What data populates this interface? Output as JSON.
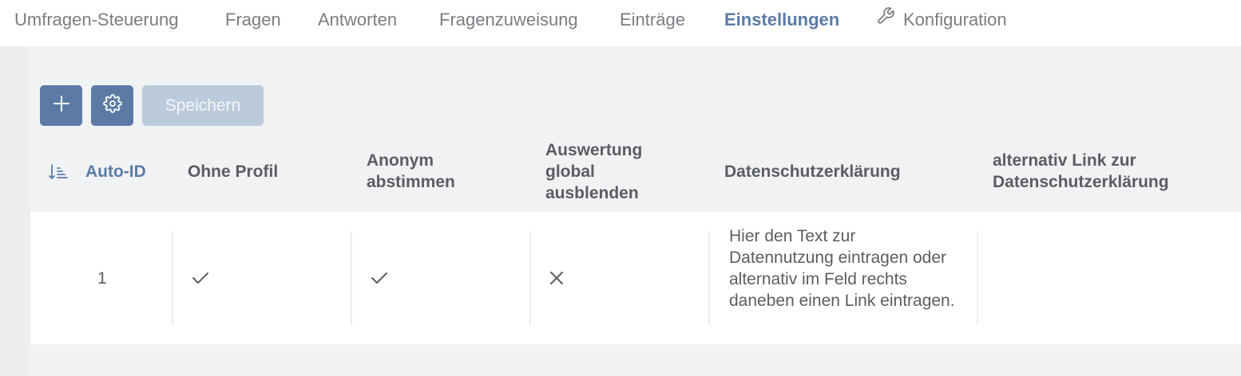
{
  "tabs": [
    {
      "label": "Umfragen-Steuerung",
      "active": false
    },
    {
      "label": "Fragen",
      "active": false
    },
    {
      "label": "Antworten",
      "active": false
    },
    {
      "label": "Fragenzuweisung",
      "active": false
    },
    {
      "label": "Einträge",
      "active": false
    },
    {
      "label": "Einstellungen",
      "active": true
    },
    {
      "label": "Konfiguration",
      "active": false,
      "icon": "wrench-icon"
    }
  ],
  "toolbar": {
    "add_icon": "plus-icon",
    "settings_icon": "gear-icon",
    "save_label": "Speichern"
  },
  "table": {
    "sort_icon": "sort-ascending-icon",
    "columns": [
      "Auto-ID",
      "Ohne Profil",
      "Anonym abstimmen",
      "Auswertung global ausblenden",
      "Datenschutzerklärung",
      "alternativ Link zur Datenschutzerklärung"
    ],
    "rows": [
      {
        "auto_id": "1",
        "ohne_profil": "check-icon",
        "anonym_abstimmen": "check-icon",
        "auswertung_ausblenden": "x-icon",
        "datenschutz": "Hier den Text zur Datennutzung eintragen oder alternativ im Feld rechts daneben einen Link eintragen.",
        "alternativ_link": ""
      }
    ]
  },
  "colors": {
    "accent": "#5b7ba6",
    "accent_disabled": "#bccbdc",
    "background": "#f1f2f4",
    "text": "#5a5d62"
  }
}
